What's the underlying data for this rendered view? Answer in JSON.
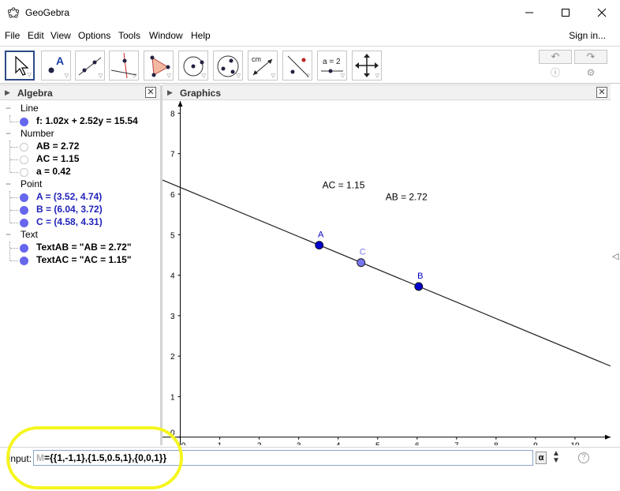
{
  "window": {
    "title": "GeoGebra"
  },
  "menu": {
    "items": [
      "File",
      "Edit",
      "View",
      "Options",
      "Tools",
      "Window",
      "Help"
    ],
    "signin": "Sign in..."
  },
  "toolbar": {
    "tools": [
      "move-tool",
      "point-tool",
      "line-tool",
      "perpendicular-line-tool",
      "polygon-tool",
      "circle-tool",
      "conic-tool",
      "distance-tool",
      "reflect-tool",
      "slider-tool",
      "move-graphics-tool"
    ],
    "cm_label": "cm",
    "slider_label": "a = 2",
    "point_label": "A"
  },
  "algebra": {
    "title": "Algebra",
    "categories": [
      {
        "label": "Line",
        "items": [
          {
            "text": "f: 1.02x + 2.52y = 15.54",
            "shown": true,
            "color": "#000000"
          }
        ]
      },
      {
        "label": "Number",
        "items": [
          {
            "text": "AB = 2.72",
            "shown": false,
            "color": "#000000"
          },
          {
            "text": "AC = 1.15",
            "shown": false,
            "color": "#000000"
          },
          {
            "text": "a = 0.42",
            "shown": false,
            "color": "#000000"
          }
        ]
      },
      {
        "label": "Point",
        "items": [
          {
            "text": "A = (3.52, 4.74)",
            "shown": true,
            "color": "#2222bb"
          },
          {
            "text": "B = (6.04, 3.72)",
            "shown": true,
            "color": "#2222bb"
          },
          {
            "text": "C = (4.58, 4.31)",
            "shown": true,
            "color": "#2222bb"
          }
        ]
      },
      {
        "label": "Text",
        "items": [
          {
            "text": "TextAB = \"AB = 2.72\"",
            "shown": true,
            "color": "#000000"
          },
          {
            "text": "TextAC = \"AC = 1.15\"",
            "shown": true,
            "color": "#000000"
          }
        ]
      }
    ]
  },
  "graphics": {
    "title": "Graphics",
    "x_ticks": [
      "0",
      "1",
      "2",
      "3",
      "4",
      "5",
      "6",
      "7",
      "8",
      "9",
      "10"
    ],
    "y_ticks": [
      "0",
      "1",
      "2",
      "3",
      "4",
      "5",
      "6",
      "7",
      "8"
    ],
    "xlim": [
      -0.45,
      10.9
    ],
    "ylim": [
      -0.2,
      8.3
    ],
    "line": {
      "a": 1.02,
      "b": 2.52,
      "c": 15.54
    },
    "points": [
      {
        "label": "A",
        "x": 3.52,
        "y": 4.74,
        "color": "#0000cc",
        "label_color": "#0000cc"
      },
      {
        "label": "B",
        "x": 6.04,
        "y": 3.72,
        "color": "#0000cc",
        "label_color": "#0000cc"
      },
      {
        "label": "C",
        "x": 4.58,
        "y": 4.31,
        "color": "#7777ee",
        "label_color": "#7777ee"
      }
    ],
    "texts": [
      {
        "text": "AC = 1.15",
        "x": 3.6,
        "y": 6.15
      },
      {
        "text": "AB = 2.72",
        "x": 5.2,
        "y": 5.85
      }
    ]
  },
  "input": {
    "label": "Input:",
    "placeholder_prefix": "M",
    "value": "={{1,-1,1},{1.5,0.5,1},{0,0,1}}",
    "alpha": "α",
    "help": "?"
  },
  "colors": {
    "accent": "#2d4b86",
    "highlight": "#f5f51e"
  }
}
